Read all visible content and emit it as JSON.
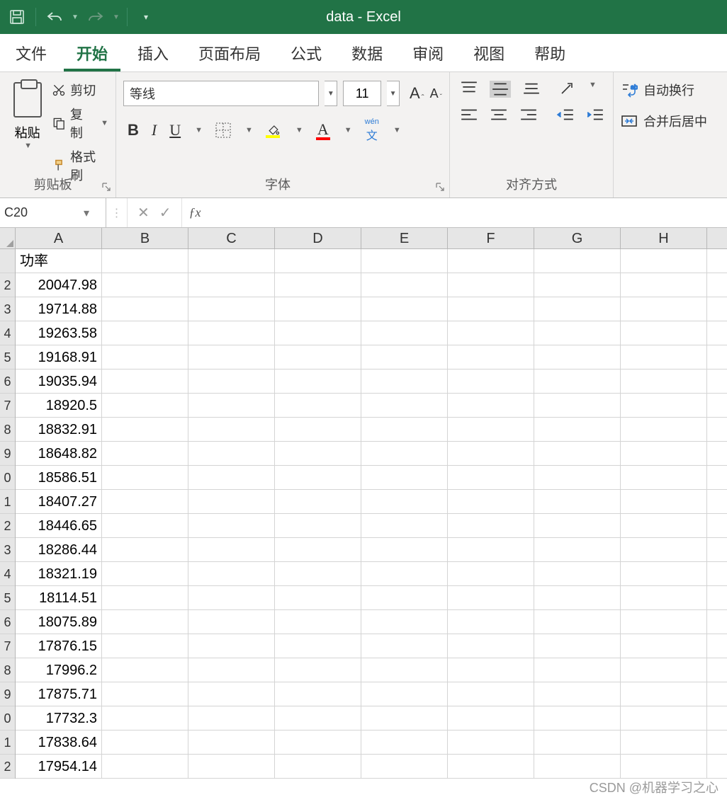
{
  "title": "data  -  Excel",
  "tabs": [
    "文件",
    "开始",
    "插入",
    "页面布局",
    "公式",
    "数据",
    "审阅",
    "视图",
    "帮助"
  ],
  "activeTab": 1,
  "ribbon": {
    "clipboard": {
      "paste": "粘贴",
      "cut": "剪切",
      "copy": "复制",
      "painter": "格式刷",
      "label": "剪贴板"
    },
    "font": {
      "name": "等线",
      "size": "11",
      "pinyin": "wén",
      "pinyinChar": "文",
      "label": "字体"
    },
    "align": {
      "label": "对齐方式"
    },
    "wrap": {
      "wrap": "自动换行",
      "merge": "合并后居中"
    }
  },
  "namebox": "C20",
  "formula": "",
  "columns": [
    "A",
    "B",
    "C",
    "D",
    "E",
    "F",
    "G",
    "H"
  ],
  "rowNums": [
    "",
    "2",
    "3",
    "4",
    "5",
    "6",
    "7",
    "8",
    "9",
    "0",
    "1",
    "2",
    "3",
    "4",
    "5",
    "6",
    "7",
    "8",
    "9",
    "0",
    "1",
    "2"
  ],
  "header": "功率",
  "values": [
    "20047.98",
    "19714.88",
    "19263.58",
    "19168.91",
    "19035.94",
    "18920.5",
    "18832.91",
    "18648.82",
    "18586.51",
    "18407.27",
    "18446.65",
    "18286.44",
    "18321.19",
    "18114.51",
    "18075.89",
    "17876.15",
    "17996.2",
    "17875.71",
    "17732.3",
    "17838.64",
    "17954.14"
  ],
  "watermark": "CSDN @机器学习之心"
}
